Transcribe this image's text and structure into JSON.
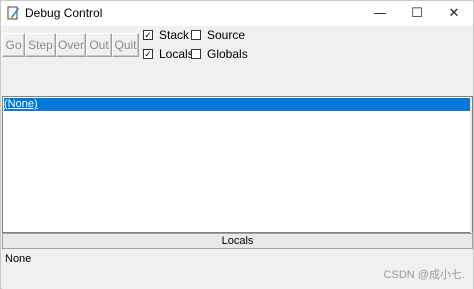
{
  "window": {
    "title": "Debug Control",
    "controls": {
      "minimize": "—",
      "maximize": "☐",
      "close": "✕"
    }
  },
  "toolbar": {
    "go_label": "Go",
    "step_label": "Step",
    "over_label": "Over",
    "out_label": "Out",
    "quit_label": "Quit"
  },
  "options": {
    "stack": {
      "label": "Stack",
      "checked": true
    },
    "source": {
      "label": "Source",
      "checked": false
    },
    "locals": {
      "label": "Locals",
      "checked": true
    },
    "globals": {
      "label": "Globals",
      "checked": false
    }
  },
  "stack_list": {
    "items": [
      "(None)"
    ],
    "selected_index": 0
  },
  "locals_panel": {
    "header": "Locals",
    "value": "None"
  },
  "watermark": "CSDN @成小七.",
  "colors": {
    "selection": "#0078d7",
    "disabled_text": "#8c8c8c"
  }
}
